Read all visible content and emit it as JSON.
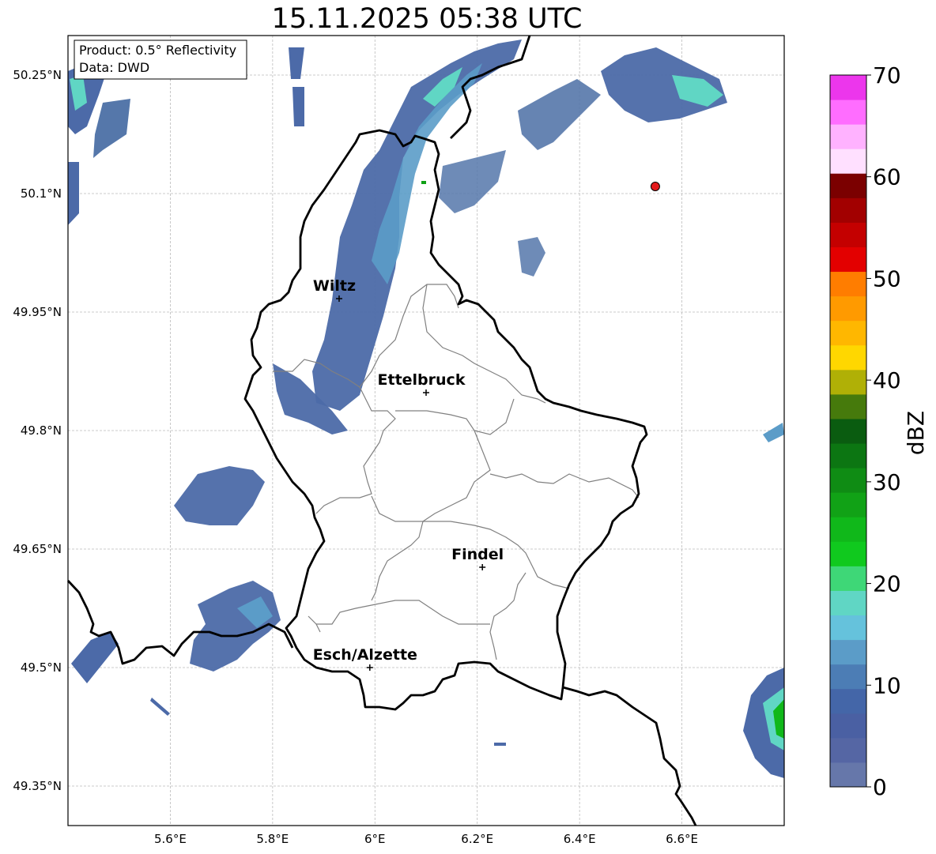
{
  "title": "15.11.2025 05:38 UTC",
  "info_box": {
    "product": "Product: 0.5° Reflectivity",
    "data": "Data: DWD"
  },
  "latitude_ticks": [
    "50.25°N",
    "50.1°N",
    "49.95°N",
    "49.8°N",
    "49.65°N",
    "49.5°N",
    "49.35°N"
  ],
  "longitude_ticks": [
    "5.6°E",
    "5.8°E",
    "6°E",
    "6.2°E",
    "6.4°E",
    "6.6°E"
  ],
  "cities": [
    {
      "name": "Wiltz",
      "lon": 5.93,
      "lat": 49.967
    },
    {
      "name": "Ettelbruck",
      "lon": 6.1,
      "lat": 49.848
    },
    {
      "name": "Findel",
      "lon": 6.21,
      "lat": 49.627
    },
    {
      "name": "Esch/Alzette",
      "lon": 5.99,
      "lat": 49.5
    }
  ],
  "radar_site": {
    "lon": 6.548,
    "lat": 50.109,
    "color": "#e31a1c"
  },
  "colorbar": {
    "label": "dBZ",
    "min": 0,
    "max": 70,
    "ticks": [
      "0",
      "10",
      "20",
      "30",
      "40",
      "50",
      "60",
      "70"
    ],
    "colors": [
      "#6677aa",
      "#5566a4",
      "#4a60a3",
      "#4466a8",
      "#4c7db5",
      "#5b9cc8",
      "#65c2dc",
      "#60d6c4",
      "#3ed777",
      "#10c91e",
      "#10b81a",
      "#11a216",
      "#0f8c14",
      "#0c7612",
      "#0a5c10",
      "#467a0c",
      "#b0b006",
      "#ffd700",
      "#ffb700",
      "#ff9a00",
      "#ff7d00",
      "#e30000",
      "#c40000",
      "#a20000",
      "#7b0000",
      "#ffe0ff",
      "#ffb2ff",
      "#ff6dff",
      "#ec36ec"
    ]
  },
  "colors": {
    "country_border": "#000000",
    "canton_border": "#808080",
    "grid": "#bbbbbb"
  }
}
